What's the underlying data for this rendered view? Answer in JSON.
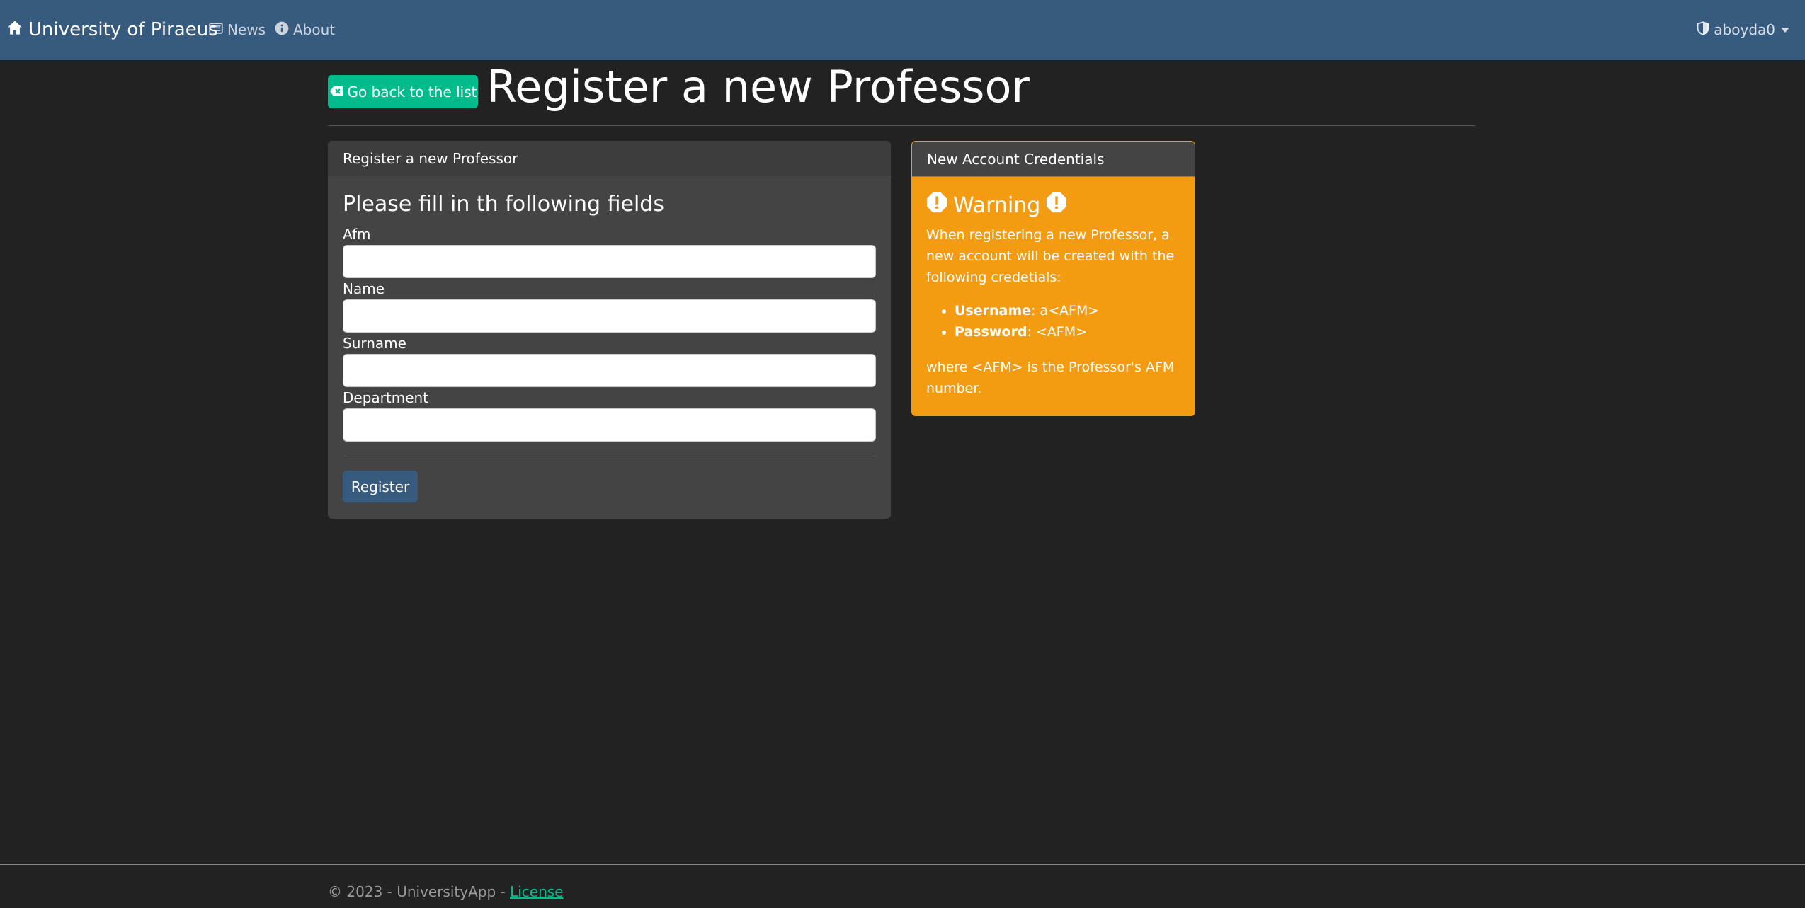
{
  "navbar": {
    "brand": "University of Piraeus",
    "links": [
      {
        "label": "News",
        "icon": "newspaper-icon"
      },
      {
        "label": "About",
        "icon": "info-circle-icon"
      }
    ],
    "user": {
      "name": "aboyda0",
      "icon": "shield-icon"
    }
  },
  "header": {
    "back_button": "Go back to the list",
    "title": "Register a new Professor"
  },
  "form_card": {
    "header": "Register a new Professor",
    "heading": "Please fill in th following fields",
    "fields": [
      {
        "label": "Afm",
        "value": "",
        "placeholder": ""
      },
      {
        "label": "Name",
        "value": "",
        "placeholder": ""
      },
      {
        "label": "Surname",
        "value": "",
        "placeholder": ""
      },
      {
        "label": "Department",
        "value": "",
        "placeholder": ""
      }
    ],
    "submit_label": "Register"
  },
  "warning_card": {
    "header": "New Account Credentials",
    "title": "Warning",
    "intro": "When registering a new Professor, a new account will be created with the following credetials:",
    "items": [
      {
        "key": "Username",
        "value": ": a<AFM>"
      },
      {
        "key": "Password",
        "value": ": <AFM>"
      }
    ],
    "note": "where <AFM> is the Professor's AFM number."
  },
  "footer": {
    "text": "© 2023 - UniversityApp - ",
    "link": "License"
  },
  "colors": {
    "navbar": "#375a7f",
    "background": "#222222",
    "success": "#00bc8c",
    "warning": "#f39c12",
    "card": "#444444"
  }
}
